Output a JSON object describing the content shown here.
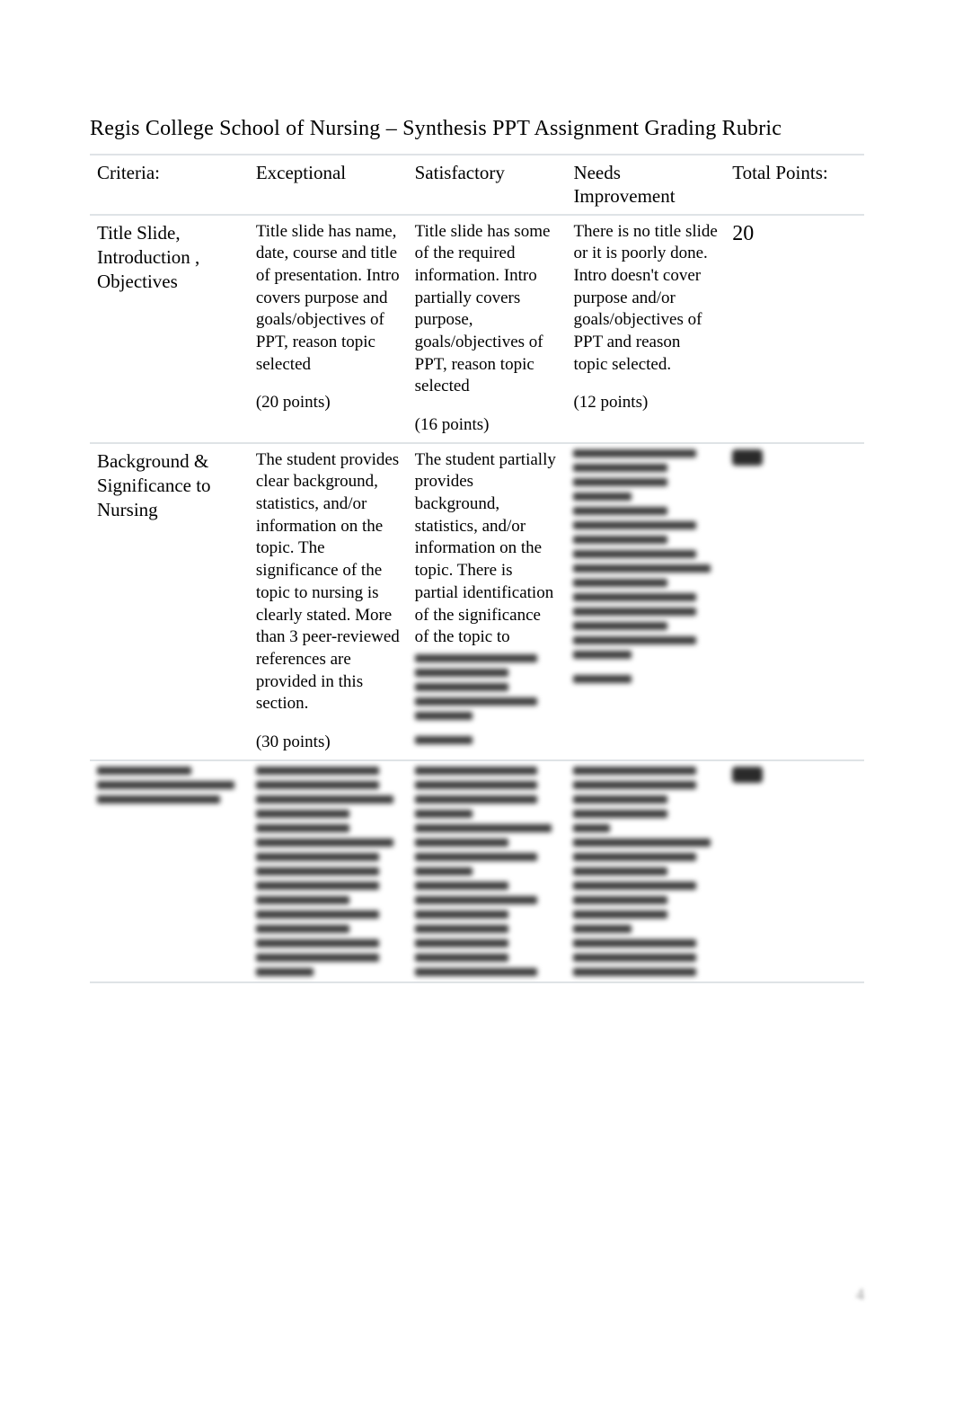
{
  "title": "Regis College School of Nursing – Synthesis PPT Assignment Grading Rubric",
  "headers": {
    "criteria": "Criteria:",
    "exceptional": "Exceptional",
    "satisfactory": "Satisfactory",
    "needs_improvement": "Needs\nImprovement",
    "total_points": "Total Points:"
  },
  "rows": [
    {
      "criteria": "Title Slide,\nIntroduction ,\nObjectives",
      "exceptional": "Title slide has name, date, course and title of presentation. Intro covers purpose and goals/objectives of PPT, reason topic selected",
      "exceptional_points": "(20 points)",
      "satisfactory": "Title slide has some of the required information. Intro partially covers purpose, goals/objectives of PPT, reason topic selected",
      "satisfactory_points": "(16 points)",
      "needs": "There is no title slide or it is poorly done. Intro doesn't cover purpose and/or goals/objectives of PPT and reason topic selected.",
      "needs_points": "(12 points)",
      "total": "20"
    },
    {
      "criteria": "Background &\nSignificance to\nNursing",
      "exceptional": "The student provides clear background, statistics, and/or information on the topic. The significance of the topic to nursing is clearly stated. More than 3 peer-reviewed references are provided in this section.",
      "exceptional_points": "(30 points)",
      "satisfactory": "The student partially provides background, statistics, and/or information on the topic. There is partial identification of the significance of the topic to",
      "satisfactory_points": "",
      "needs": "",
      "needs_points": "",
      "total": ""
    }
  ],
  "page_number": "4"
}
